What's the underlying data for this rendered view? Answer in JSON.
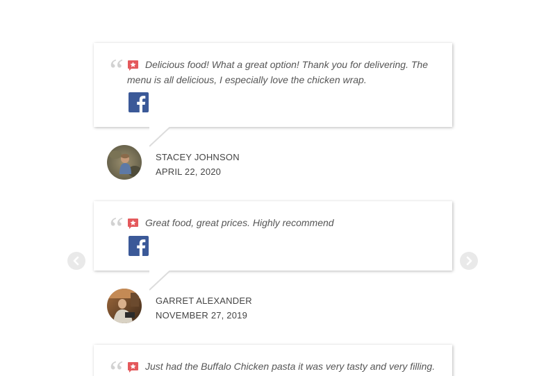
{
  "navigation": {
    "prev_icon": "chevron-left-icon",
    "next_icon": "chevron-right-icon"
  },
  "reviews": [
    {
      "text": "Delicious food! What a great option! Thank you for delivering. The menu is all delicious, I especially love the chicken wrap.",
      "source_icon": "yelp-icon",
      "share_icon": "facebook-icon",
      "author": "STACEY JOHNSON",
      "date": "APRIL 22, 2020"
    },
    {
      "text": "Great food, great prices. Highly recommend",
      "source_icon": "yelp-icon",
      "share_icon": "facebook-icon",
      "author": "GARRET ALEXANDER",
      "date": "NOVEMBER 27, 2019"
    },
    {
      "text": "Just had the Buffalo Chicken pasta it was very tasty and very filling.",
      "source_icon": "yelp-icon"
    }
  ],
  "colors": {
    "yelp_red": "#e4595c",
    "facebook_blue": "#3b5998",
    "quote_gray": "#d2d2d2",
    "text_gray": "#555555"
  }
}
